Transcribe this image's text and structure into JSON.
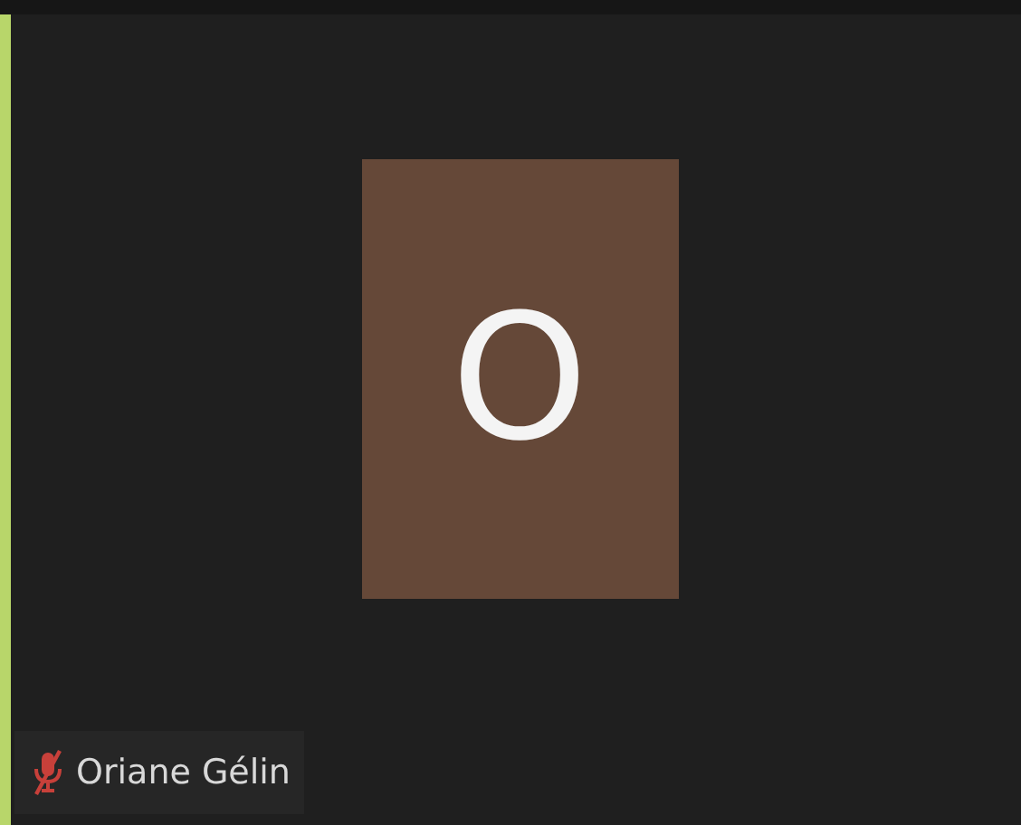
{
  "participant": {
    "name": "Oriane Gélin",
    "initial": "O",
    "muted": true,
    "active_speaker": true
  }
}
